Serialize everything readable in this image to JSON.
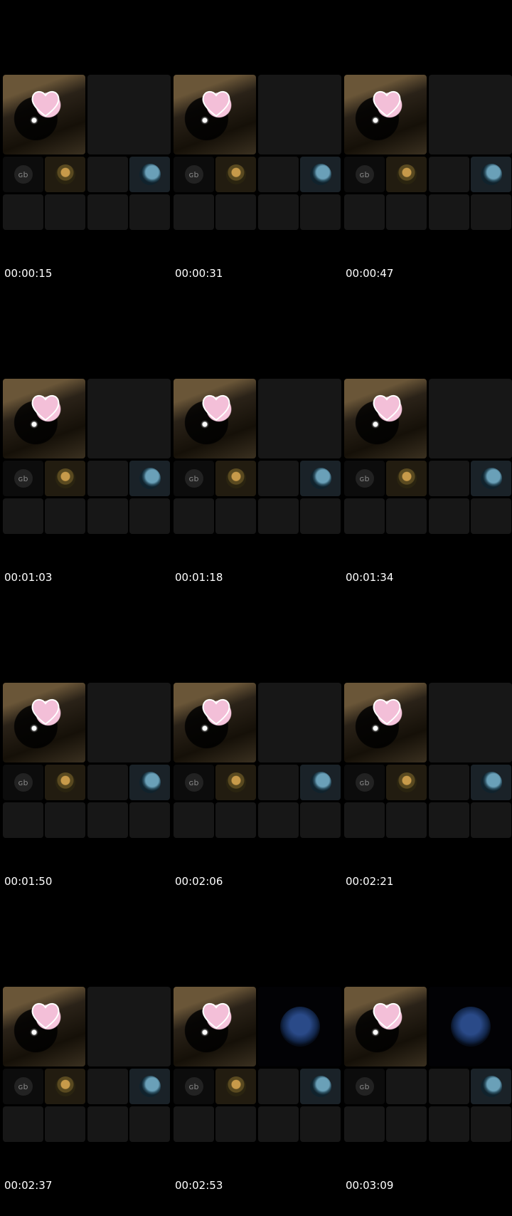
{
  "frames": [
    {
      "timestamp": "00:00:15",
      "variant": "a"
    },
    {
      "timestamp": "00:00:31",
      "variant": "a"
    },
    {
      "timestamp": "00:00:47",
      "variant": "a"
    },
    {
      "timestamp": "00:01:03",
      "variant": "a"
    },
    {
      "timestamp": "00:01:18",
      "variant": "a"
    },
    {
      "timestamp": "00:01:34",
      "variant": "a"
    },
    {
      "timestamp": "00:01:50",
      "variant": "a"
    },
    {
      "timestamp": "00:02:06",
      "variant": "a"
    },
    {
      "timestamp": "00:02:21",
      "variant": "a"
    },
    {
      "timestamp": "00:02:37",
      "variant": "a"
    },
    {
      "timestamp": "00:02:53",
      "variant": "b"
    },
    {
      "timestamp": "00:03:09",
      "variant": "c"
    }
  ],
  "icons": {
    "logo": "logo-avatar-icon",
    "mona": "mona-lisa-avatar-icon",
    "globe": "globe-avatar-icon",
    "silhouette": "silhouette-avatar-icon",
    "heart": "heart-sticker-icon"
  },
  "colors": {
    "background": "#000000",
    "tile": "#171717",
    "heart": "#f6c6dd"
  }
}
